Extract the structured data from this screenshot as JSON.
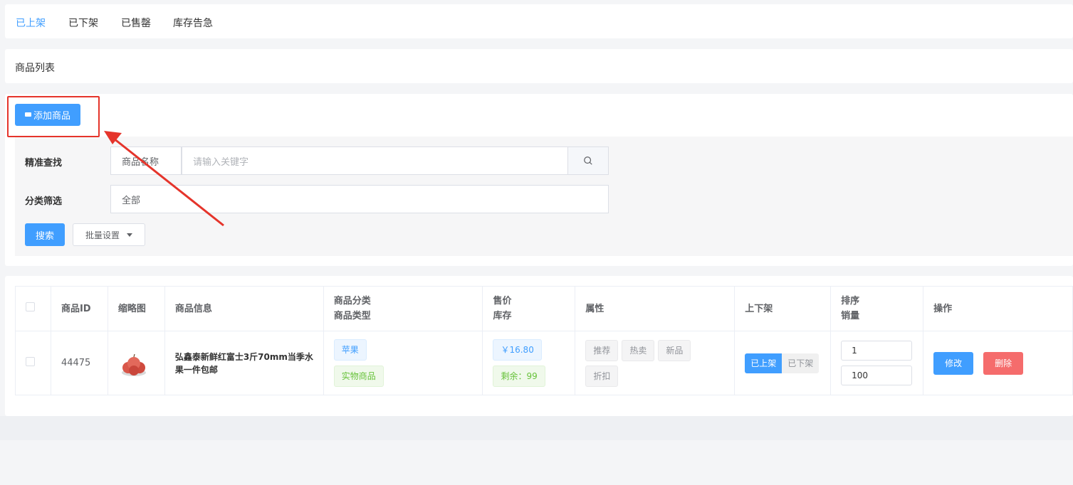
{
  "tabs": [
    {
      "label": "已上架",
      "active": true
    },
    {
      "label": "已下架",
      "active": false
    },
    {
      "label": "已售罄",
      "active": false
    },
    {
      "label": "库存告急",
      "active": false
    }
  ],
  "list_title": "商品列表",
  "toolbar": {
    "add_label": "添加商品"
  },
  "filter": {
    "exact_label": "精准查找",
    "field_select": "商品名称",
    "keyword_placeholder": "请输入关键字",
    "category_label": "分类筛选",
    "category_value": "全部",
    "search_label": "搜索",
    "batch_label": "批量设置"
  },
  "table": {
    "headers": {
      "id": "商品ID",
      "thumb": "缩略图",
      "info": "商品信息",
      "category": "商品分类",
      "type": "商品类型",
      "price": "售价",
      "stock": "库存",
      "attrs": "属性",
      "shelf": "上下架",
      "sort": "排序",
      "sales": "销量",
      "ops": "操作"
    },
    "rows": [
      {
        "id": "44475",
        "name": "弘鑫泰新鲜红富士3斤70mm当季水果一件包邮",
        "category": "苹果",
        "type": "实物商品",
        "price": "￥16.80",
        "stock": "剩余：99",
        "attrs": [
          "推荐",
          "热卖",
          "新品",
          "折扣"
        ],
        "shelf_on": "已上架",
        "shelf_off": "已下架",
        "sort": "1",
        "sales": "100",
        "edit": "修改",
        "delete": "删除"
      }
    ]
  },
  "colors": {
    "primary": "#409eff",
    "danger": "#f56c6c",
    "annotation": "#e5342b"
  }
}
